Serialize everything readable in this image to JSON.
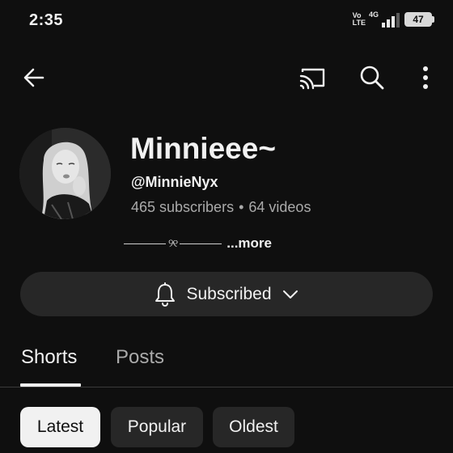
{
  "status_bar": {
    "time": "2:35",
    "volte_top": "Vo",
    "volte_bottom": "LTE",
    "network": "4G",
    "battery": "47"
  },
  "top_bar": {
    "icons": [
      "back-arrow-icon",
      "cast-icon",
      "search-icon",
      "more-vert-icon"
    ]
  },
  "channel": {
    "name": "Minnieee~",
    "handle": "@MinnieNyx",
    "subscribers": "465 subscribers",
    "separator": "•",
    "videos": "64 videos",
    "description_glyph": "୨୧",
    "more_label": "...more"
  },
  "subscribe_button": {
    "label": "Subscribed",
    "icon": "bell-icon",
    "dropdown_icon": "chevron-down-icon"
  },
  "tabs": [
    {
      "label": "Shorts",
      "active": true
    },
    {
      "label": "Posts",
      "active": false
    }
  ],
  "chips": [
    {
      "label": "Latest",
      "selected": true
    },
    {
      "label": "Popular",
      "selected": false
    },
    {
      "label": "Oldest",
      "selected": false
    }
  ],
  "colors": {
    "background": "#0f0f0f",
    "surface": "#272727",
    "text_primary": "#f1f1f1",
    "text_secondary": "#aaaaaa",
    "chip_selected_bg": "#f1f1f1"
  }
}
